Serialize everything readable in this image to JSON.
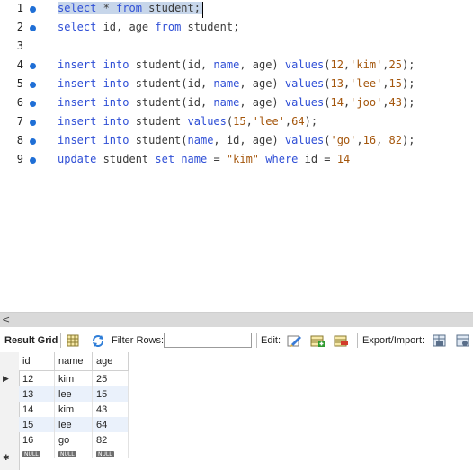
{
  "editor": {
    "lines": [
      {
        "num": "1",
        "dot": true,
        "tokens": [
          {
            "t": "select",
            "c": "k"
          },
          {
            "t": " * ",
            "c": "c"
          },
          {
            "t": "from",
            "c": "k"
          },
          {
            "t": " student;",
            "c": "c"
          }
        ],
        "selected": true
      },
      {
        "num": "2",
        "dot": true,
        "tokens": [
          {
            "t": "select",
            "c": "k"
          },
          {
            "t": " id, age ",
            "c": "c"
          },
          {
            "t": "from",
            "c": "k"
          },
          {
            "t": " student;",
            "c": "c"
          }
        ]
      },
      {
        "num": "3",
        "dot": false,
        "tokens": []
      },
      {
        "num": "4",
        "dot": true,
        "tokens": [
          {
            "t": "insert into",
            "c": "k"
          },
          {
            "t": " student(id, ",
            "c": "c"
          },
          {
            "t": "name",
            "c": "k"
          },
          {
            "t": ", age) ",
            "c": "c"
          },
          {
            "t": "values",
            "c": "k"
          },
          {
            "t": "(",
            "c": "c"
          },
          {
            "t": "12",
            "c": "n"
          },
          {
            "t": ",",
            "c": "c"
          },
          {
            "t": "'kim'",
            "c": "s"
          },
          {
            "t": ",",
            "c": "c"
          },
          {
            "t": "25",
            "c": "n"
          },
          {
            "t": ");",
            "c": "c"
          }
        ]
      },
      {
        "num": "5",
        "dot": true,
        "tokens": [
          {
            "t": "insert into",
            "c": "k"
          },
          {
            "t": " student(id, ",
            "c": "c"
          },
          {
            "t": "name",
            "c": "k"
          },
          {
            "t": ", age) ",
            "c": "c"
          },
          {
            "t": "values",
            "c": "k"
          },
          {
            "t": "(",
            "c": "c"
          },
          {
            "t": "13",
            "c": "n"
          },
          {
            "t": ",",
            "c": "c"
          },
          {
            "t": "'lee'",
            "c": "s"
          },
          {
            "t": ",",
            "c": "c"
          },
          {
            "t": "15",
            "c": "n"
          },
          {
            "t": ");",
            "c": "c"
          }
        ]
      },
      {
        "num": "6",
        "dot": true,
        "tokens": [
          {
            "t": "insert into",
            "c": "k"
          },
          {
            "t": " student(id, ",
            "c": "c"
          },
          {
            "t": "name",
            "c": "k"
          },
          {
            "t": ", age) ",
            "c": "c"
          },
          {
            "t": "values",
            "c": "k"
          },
          {
            "t": "(",
            "c": "c"
          },
          {
            "t": "14",
            "c": "n"
          },
          {
            "t": ",",
            "c": "c"
          },
          {
            "t": "'joo'",
            "c": "s"
          },
          {
            "t": ",",
            "c": "c"
          },
          {
            "t": "43",
            "c": "n"
          },
          {
            "t": ");",
            "c": "c"
          }
        ]
      },
      {
        "num": "7",
        "dot": true,
        "tokens": [
          {
            "t": "insert into",
            "c": "k"
          },
          {
            "t": " student ",
            "c": "c"
          },
          {
            "t": "values",
            "c": "k"
          },
          {
            "t": "(",
            "c": "c"
          },
          {
            "t": "15",
            "c": "n"
          },
          {
            "t": ",",
            "c": "c"
          },
          {
            "t": "'lee'",
            "c": "s"
          },
          {
            "t": ",",
            "c": "c"
          },
          {
            "t": "64",
            "c": "n"
          },
          {
            "t": ");",
            "c": "c"
          }
        ]
      },
      {
        "num": "8",
        "dot": true,
        "tokens": [
          {
            "t": "insert into",
            "c": "k"
          },
          {
            "t": " student(",
            "c": "c"
          },
          {
            "t": "name",
            "c": "k"
          },
          {
            "t": ", id, age) ",
            "c": "c"
          },
          {
            "t": "values",
            "c": "k"
          },
          {
            "t": "(",
            "c": "c"
          },
          {
            "t": "'go'",
            "c": "s"
          },
          {
            "t": ",",
            "c": "c"
          },
          {
            "t": "16",
            "c": "n"
          },
          {
            "t": ", ",
            "c": "c"
          },
          {
            "t": "82",
            "c": "n"
          },
          {
            "t": ");",
            "c": "c"
          }
        ]
      },
      {
        "num": "9",
        "dot": true,
        "tokens": [
          {
            "t": "update",
            "c": "k"
          },
          {
            "t": " student ",
            "c": "c"
          },
          {
            "t": "set",
            "c": "k"
          },
          {
            "t": " ",
            "c": "c"
          },
          {
            "t": "name",
            "c": "k"
          },
          {
            "t": " = ",
            "c": "c"
          },
          {
            "t": "\"kim\"",
            "c": "s"
          },
          {
            "t": " ",
            "c": "c"
          },
          {
            "t": "where",
            "c": "k"
          },
          {
            "t": " id = ",
            "c": "c"
          },
          {
            "t": "14",
            "c": "n"
          }
        ]
      }
    ]
  },
  "scrollbar": {
    "left_arrow": "<"
  },
  "toolbar": {
    "result_grid_label": "Result Grid",
    "filter_rows_label": "Filter Rows:",
    "filter_value": "",
    "edit_label": "Edit:",
    "export_import_label": "Export/Import:"
  },
  "grid": {
    "columns": [
      "id",
      "name",
      "age"
    ],
    "rows": [
      [
        "12",
        "kim",
        "25"
      ],
      [
        "13",
        "lee",
        "15"
      ],
      [
        "14",
        "kim",
        "43"
      ],
      [
        "15",
        "lee",
        "64"
      ],
      [
        "16",
        "go",
        "82"
      ]
    ],
    "null_label": "NULL",
    "current_row_marker": "▶",
    "new_row_marker": "✱"
  },
  "colors": {
    "keyword": "#2f4fd6",
    "string_number": "#a4560c",
    "line_dot": "#1f6fd6",
    "selection": "#c7d6ea",
    "alt_row": "#eaf1fb"
  }
}
